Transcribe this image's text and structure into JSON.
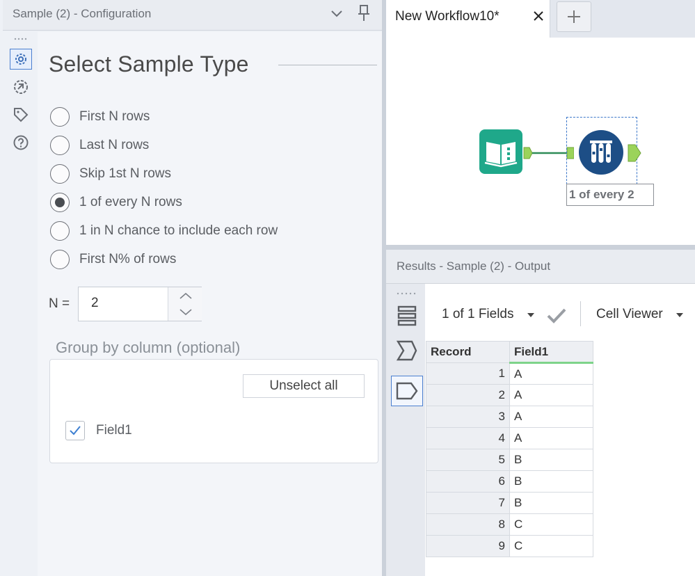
{
  "config_panel": {
    "title": "Sample (2) - Configuration",
    "section_title": "Select Sample Type",
    "sample_options": [
      {
        "label": "First N rows",
        "selected": false
      },
      {
        "label": "Last N rows",
        "selected": false
      },
      {
        "label": "Skip 1st N rows",
        "selected": false
      },
      {
        "label": "1 of every N rows",
        "selected": true
      },
      {
        "label": "1 in N chance to include each row",
        "selected": false
      },
      {
        "label": "First N% of rows",
        "selected": false
      }
    ],
    "n_label": "N =",
    "n_value": "2",
    "group_by_title": "Group by column (optional)",
    "unselect_all_label": "Unselect all",
    "columns": [
      {
        "label": "Field1",
        "checked": true
      }
    ],
    "rail_icons": [
      "gear-icon",
      "navigate-icon",
      "tag-icon",
      "help-icon"
    ]
  },
  "workflow": {
    "tab_label": "New Workflow10*",
    "tab_close_icon": "close-icon",
    "add_tab_icon": "plus-icon",
    "node_annotation": "1 of every 2",
    "colors": {
      "browse_tool": "#1fa88a",
      "sample_tool": "#1d4e86",
      "connector": "#9bd35a",
      "selection": "#3c77c9"
    }
  },
  "results": {
    "title": "Results - Sample (2) - Output",
    "fields_label": "1 of 1 Fields",
    "cell_viewer_label": "Cell Viewer",
    "columns": [
      "Record",
      "Field1"
    ],
    "rows": [
      {
        "record": "1",
        "field1": "A"
      },
      {
        "record": "2",
        "field1": "A"
      },
      {
        "record": "3",
        "field1": "A"
      },
      {
        "record": "4",
        "field1": "A"
      },
      {
        "record": "5",
        "field1": "B"
      },
      {
        "record": "6",
        "field1": "B"
      },
      {
        "record": "7",
        "field1": "B"
      },
      {
        "record": "8",
        "field1": "C"
      },
      {
        "record": "9",
        "field1": "C"
      }
    ]
  }
}
